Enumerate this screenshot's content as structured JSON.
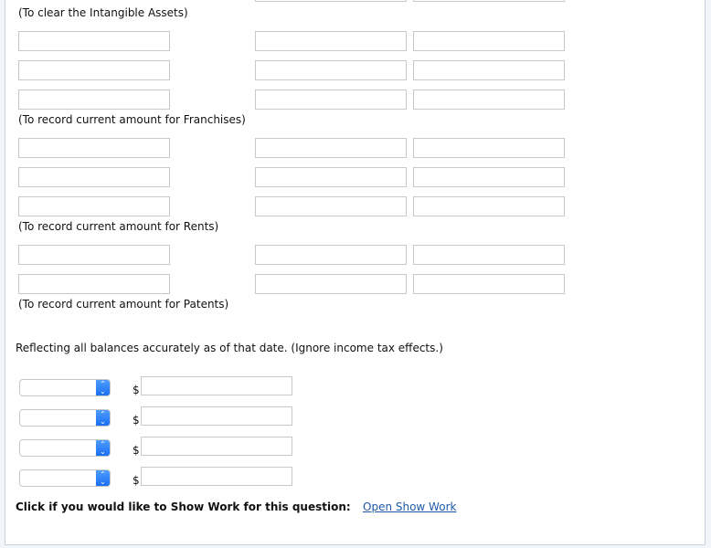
{
  "journal": {
    "groups": [
      {
        "note": "(To clear the Intangible Assets)"
      },
      {
        "note": "(To record current amount for Franchises)"
      },
      {
        "note": "(To record current amount for Rents)"
      },
      {
        "note": "(To record current amount for Patents)"
      }
    ],
    "inputs": {
      "account_value": "",
      "debit_value": "",
      "credit_value": ""
    }
  },
  "balance_sheet": {
    "instruction": "Reflecting all balances accurately as of that date. (Ignore income tax effects.)",
    "currency_symbol": "$",
    "rows": [
      {
        "selected": "",
        "amount": ""
      },
      {
        "selected": "",
        "amount": ""
      },
      {
        "selected": "",
        "amount": ""
      },
      {
        "selected": "",
        "amount": ""
      }
    ],
    "select_arrow_icon": "up-down-chevron-icon"
  },
  "show_work": {
    "prompt": "Click if you would like to Show Work for this question:",
    "link_label": "Open Show Work",
    "link_color": "#1e5aa8"
  },
  "colors": {
    "select_accent": "#1a6ff2",
    "input_border": "#c8c8c8",
    "panel_border": "#c9d2dc",
    "page_background": "#f2f6fb"
  }
}
